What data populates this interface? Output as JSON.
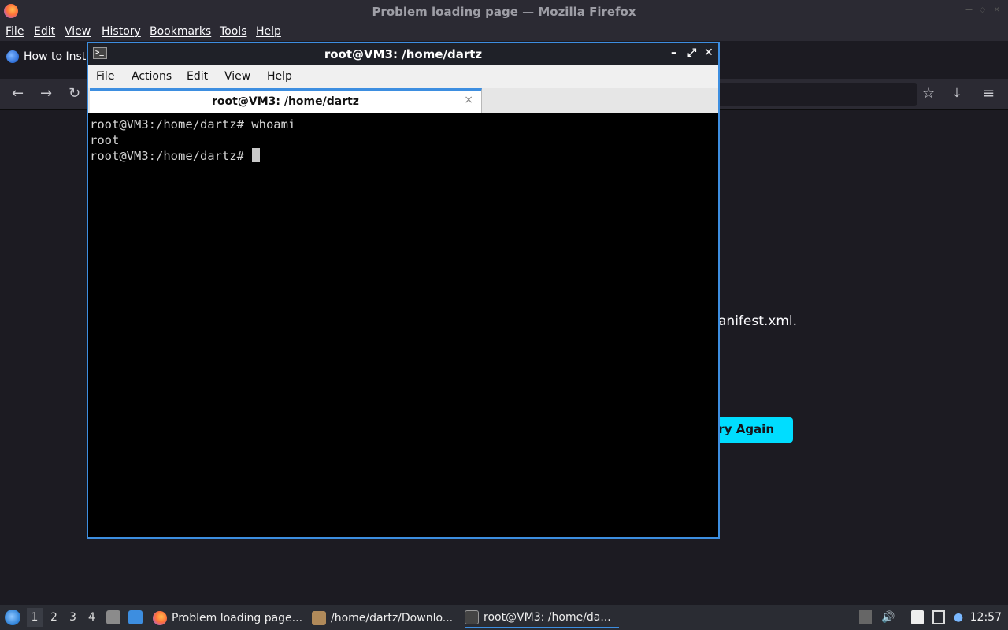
{
  "firefox": {
    "window_title": "Problem loading page — Mozilla Firefox",
    "menu": [
      "File",
      "Edit",
      "View",
      "History",
      "Bookmarks",
      "Tools",
      "Help"
    ],
    "tab_label": "How to Insta",
    "error_fragment": "anifest.xml.",
    "try_again_label": "ry Again"
  },
  "terminal": {
    "window_title": "root@VM3: /home/dartz",
    "menu": [
      "File",
      "Actions",
      "Edit",
      "View",
      "Help"
    ],
    "tab_label": "root@VM3: /home/dartz",
    "tab_close": "×",
    "lines": [
      "root@VM3:/home/dartz# whoami",
      "root",
      "root@VM3:/home/dartz# "
    ]
  },
  "taskbar": {
    "workspaces": [
      "1",
      "2",
      "3",
      "4"
    ],
    "items": [
      {
        "label": "Problem loading page...",
        "icon": "firefox-icon"
      },
      {
        "label": "/home/dartz/Downlo...",
        "icon": "archive-icon"
      },
      {
        "label": "root@VM3: /home/da...",
        "icon": "terminal-icon"
      }
    ],
    "clock": "12:57"
  },
  "colors": {
    "accent": "#3d8ee0",
    "try_again_button": "#00ddff"
  }
}
